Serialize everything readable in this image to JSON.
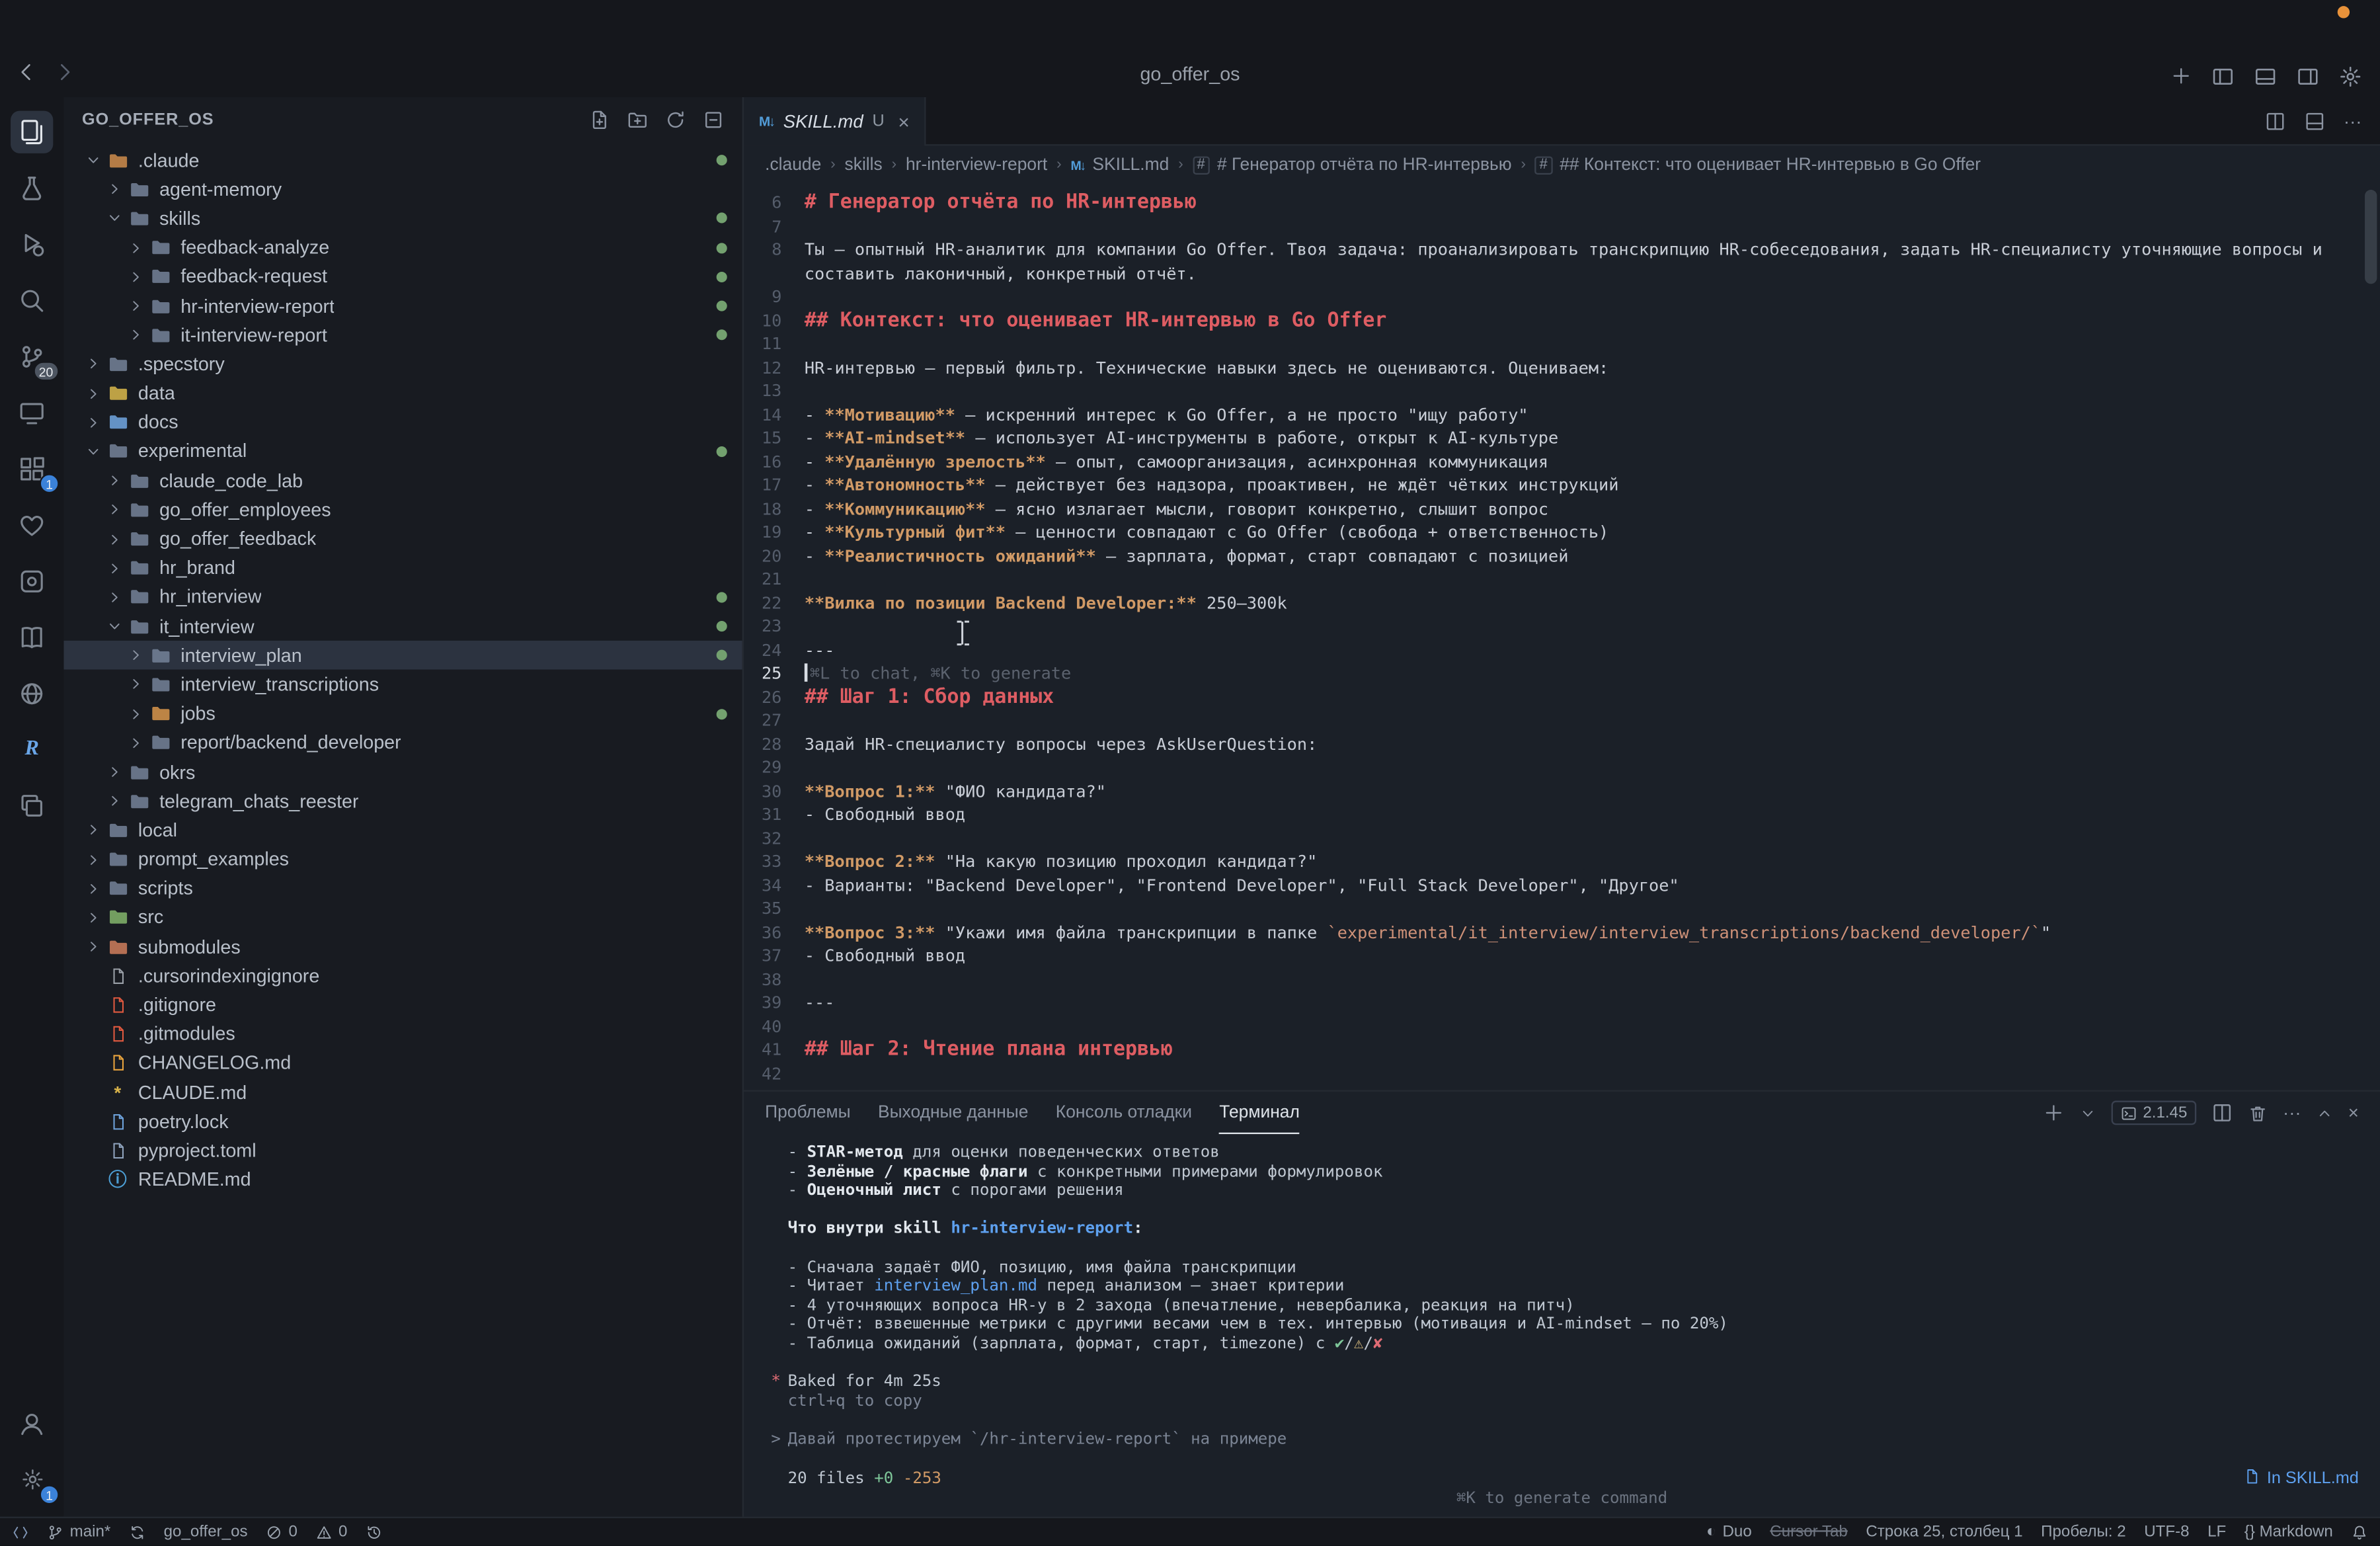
{
  "window": {
    "title": "go_offer_os"
  },
  "titlebar": {
    "nav": [
      {
        "name": "history-back-button",
        "icon": "back"
      },
      {
        "name": "history-forward-button",
        "icon": "fwd",
        "dim": true
      }
    ],
    "actions": [
      {
        "name": "new-window-button",
        "icon": "plus"
      },
      {
        "name": "toggle-primary-sidebar-button",
        "icon": "pleft"
      },
      {
        "name": "toggle-panel-button",
        "icon": "pbottom"
      },
      {
        "name": "toggle-secondary-sidebar-button",
        "icon": "pright"
      },
      {
        "name": "settings-gear-button",
        "icon": "gear"
      }
    ]
  },
  "activity_bar": {
    "top": [
      {
        "name": "explorer-view",
        "icon": "explorer",
        "active": true
      },
      {
        "name": "testing-view",
        "icon": "beaker"
      },
      {
        "name": "run-debug-view",
        "icon": "debug"
      },
      {
        "name": "search-view",
        "icon": "search"
      },
      {
        "name": "source-control-view",
        "icon": "scm",
        "badge": "20",
        "badge_style": "gray"
      },
      {
        "name": "remote-explorer-view",
        "icon": "remote"
      },
      {
        "name": "extensions-view",
        "icon": "ext",
        "badge": "1",
        "badge_style": "blue"
      },
      {
        "name": "health-view",
        "icon": "heart"
      },
      {
        "name": "tools-view",
        "icon": "tools"
      },
      {
        "name": "docs-view",
        "icon": "book"
      },
      {
        "name": "web-view",
        "icon": "globe"
      },
      {
        "name": "r-extension-view",
        "icon": "rlogo"
      },
      {
        "name": "snippets-view",
        "icon": "copy"
      }
    ],
    "bottom": [
      {
        "name": "accounts-menu",
        "icon": "account"
      },
      {
        "name": "manage-settings",
        "icon": "gear",
        "badge": "1",
        "badge_style": "blue"
      }
    ]
  },
  "sidebar": {
    "title": "GO_OFFER_OS",
    "actions": [
      {
        "name": "new-file-button",
        "icon": "newfile"
      },
      {
        "name": "new-folder-button",
        "icon": "newfolder"
      },
      {
        "name": "refresh-explorer-button",
        "icon": "refresh"
      },
      {
        "name": "collapse-folders-button",
        "icon": "collapse"
      }
    ],
    "tree": [
      {
        "label": ".claude",
        "depth": 0,
        "kind": "folder",
        "expanded": true,
        "color": "#c98a4b",
        "dot": true
      },
      {
        "label": "agent-memory",
        "depth": 1,
        "kind": "folder"
      },
      {
        "label": "skills",
        "depth": 1,
        "kind": "folder",
        "expanded": true,
        "dot": true
      },
      {
        "label": "feedback-analyze",
        "depth": 2,
        "kind": "folder",
        "dot": true
      },
      {
        "label": "feedback-request",
        "depth": 2,
        "kind": "folder",
        "dot": true
      },
      {
        "label": "hr-interview-report",
        "depth": 2,
        "kind": "folder",
        "dot": true
      },
      {
        "label": "it-interview-report",
        "depth": 2,
        "kind": "folder",
        "dot": true
      },
      {
        "label": ".specstory",
        "depth": 0,
        "kind": "folder"
      },
      {
        "label": "data",
        "depth": 0,
        "kind": "folder",
        "color": "#d4b44a"
      },
      {
        "label": "docs",
        "depth": 0,
        "kind": "folder",
        "color": "#6ea3dc"
      },
      {
        "label": "experimental",
        "depth": 0,
        "kind": "folder",
        "expanded": true,
        "dot": true
      },
      {
        "label": "claude_code_lab",
        "depth": 1,
        "kind": "folder"
      },
      {
        "label": "go_offer_employees",
        "depth": 1,
        "kind": "folder"
      },
      {
        "label": "go_offer_feedback",
        "depth": 1,
        "kind": "folder"
      },
      {
        "label": "hr_brand",
        "depth": 1,
        "kind": "folder"
      },
      {
        "label": "hr_interview",
        "depth": 1,
        "kind": "folder",
        "dot": true
      },
      {
        "label": "it_interview",
        "depth": 1,
        "kind": "folder",
        "expanded": true,
        "dot": true
      },
      {
        "label": "interview_plan",
        "depth": 2,
        "kind": "folder",
        "selected": true,
        "dot": true
      },
      {
        "label": "interview_transcriptions",
        "depth": 2,
        "kind": "folder"
      },
      {
        "label": "jobs",
        "depth": 2,
        "kind": "folder",
        "color": "#d4934a",
        "dot": true
      },
      {
        "label": "report/backend_developer",
        "depth": 2,
        "kind": "folder"
      },
      {
        "label": "okrs",
        "depth": 1,
        "kind": "folder"
      },
      {
        "label": "telegram_chats_reester",
        "depth": 1,
        "kind": "folder"
      },
      {
        "label": "local",
        "depth": 0,
        "kind": "folder"
      },
      {
        "label": "prompt_examples",
        "depth": 0,
        "kind": "folder"
      },
      {
        "label": "scripts",
        "depth": 0,
        "kind": "folder"
      },
      {
        "label": "src",
        "depth": 0,
        "kind": "folder",
        "color": "#7fb069"
      },
      {
        "label": "submodules",
        "depth": 0,
        "kind": "folder",
        "color": "#c97b5a"
      },
      {
        "label": ".cursorindexingignore",
        "depth": 0,
        "kind": "file",
        "color": "#9aa0a8"
      },
      {
        "label": ".gitignore",
        "depth": 0,
        "kind": "file",
        "color": "#e0593f"
      },
      {
        "label": ".gitmodules",
        "depth": 0,
        "kind": "file",
        "color": "#e0593f"
      },
      {
        "label": "CHANGELOG.md",
        "depth": 0,
        "kind": "file",
        "color": "#e8a33d"
      },
      {
        "label": "CLAUDE.md",
        "depth": 0,
        "kind": "file",
        "color": "#d9b44a",
        "glyph": "*"
      },
      {
        "label": "poetry.lock",
        "depth": 0,
        "kind": "file",
        "color": "#6ea3dc"
      },
      {
        "label": "pyproject.toml",
        "depth": 0,
        "kind": "file",
        "color": "#8fa3bd"
      },
      {
        "label": "README.md",
        "depth": 0,
        "kind": "file",
        "color": "#4d9fd6",
        "glyph": "ⓘ"
      }
    ]
  },
  "editor": {
    "tab": {
      "name": "SKILL.md",
      "badge": "U"
    },
    "tab_actions": [
      {
        "name": "split-editor-button",
        "icon": "split"
      },
      {
        "name": "toggle-editor-layout-button",
        "icon": "layout"
      },
      {
        "name": "more-editor-actions-button",
        "icon": "more"
      }
    ],
    "breadcrumbs": [
      {
        "label": ".claude"
      },
      {
        "label": "skills"
      },
      {
        "label": "hr-interview-report"
      },
      {
        "label": "SKILL.md",
        "icon": "md"
      },
      {
        "label": "# Генератор отчёта по HR-интервью",
        "icon": "sym"
      },
      {
        "label": "## Контекст: что оценивает HR-интервью в Go Offer",
        "icon": "sym"
      }
    ],
    "ghost_text": "⌘L to chat, ⌘K to generate",
    "lines": [
      {
        "n": 6,
        "s": [
          [
            "h",
            "# Генератор отчёта по HR-интервью"
          ]
        ]
      },
      {
        "n": 7,
        "s": []
      },
      {
        "n": 8,
        "s": [
          [
            "d",
            "Ты — опытный HR-аналитик для компании Go Offer. Твоя задача: проанализировать транскрипцию HR-собеседования, задать HR-специалисту уточняющие вопросы и"
          ]
        ]
      },
      {
        "s": [
          [
            "d",
            "составить лаконичный, конкретный отчёт."
          ]
        ]
      },
      {
        "n": 9,
        "s": []
      },
      {
        "n": 10,
        "s": [
          [
            "h",
            "## Контекст: что оценивает HR-интервью в Go Offer"
          ]
        ]
      },
      {
        "n": 11,
        "s": []
      },
      {
        "n": 12,
        "s": [
          [
            "d",
            "HR-интервью — первый фильтр. Технические навыки здесь не оцениваются. Оцениваем:"
          ]
        ]
      },
      {
        "n": 13,
        "s": []
      },
      {
        "n": 14,
        "s": [
          [
            "d",
            "- "
          ],
          [
            "b",
            "**Мотивацию**"
          ],
          [
            "d",
            " — искренний интерес к Go Offer, а не просто \"ищу работу\""
          ]
        ]
      },
      {
        "n": 15,
        "s": [
          [
            "d",
            "- "
          ],
          [
            "b",
            "**AI-mindset**"
          ],
          [
            "d",
            " — использует AI-инструменты в работе, открыт к AI-культуре"
          ]
        ]
      },
      {
        "n": 16,
        "s": [
          [
            "d",
            "- "
          ],
          [
            "b",
            "**Удалённую зрелость**"
          ],
          [
            "d",
            " — опыт, самоорганизация, асинхронная коммуникация"
          ]
        ]
      },
      {
        "n": 17,
        "s": [
          [
            "d",
            "- "
          ],
          [
            "b",
            "**Автономность**"
          ],
          [
            "d",
            " — действует без надзора, проактивен, не ждёт чётких инструкций"
          ]
        ]
      },
      {
        "n": 18,
        "s": [
          [
            "d",
            "- "
          ],
          [
            "b",
            "**Коммуникацию**"
          ],
          [
            "d",
            " — ясно излагает мысли, говорит конкретно, слышит вопрос"
          ]
        ]
      },
      {
        "n": 19,
        "s": [
          [
            "d",
            "- "
          ],
          [
            "b",
            "**Культурный фит**"
          ],
          [
            "d",
            " — ценности совпадают с Go Offer (свобода + ответственность)"
          ]
        ]
      },
      {
        "n": 20,
        "s": [
          [
            "d",
            "- "
          ],
          [
            "b",
            "**Реалистичность ожиданий**"
          ],
          [
            "d",
            " — зарплата, формат, старт совпадают с позицией"
          ]
        ]
      },
      {
        "n": 21,
        "s": []
      },
      {
        "n": 22,
        "s": [
          [
            "b",
            "**Вилка по позиции Backend Developer:**"
          ],
          [
            "d",
            " 250–300k"
          ]
        ]
      },
      {
        "n": 23,
        "s": []
      },
      {
        "n": 24,
        "s": [
          [
            "d",
            "---"
          ]
        ]
      },
      {
        "n": 25,
        "active": true,
        "caret": true,
        "s": [
          [
            "g",
            "⌘L to chat, ⌘K to generate"
          ]
        ]
      },
      {
        "n": 26,
        "s": [
          [
            "h",
            "## Шаг 1: Сбор данных"
          ]
        ]
      },
      {
        "n": 27,
        "s": []
      },
      {
        "n": 28,
        "s": [
          [
            "d",
            "Задай HR-специалисту вопросы через AskUserQuestion:"
          ]
        ]
      },
      {
        "n": 29,
        "s": []
      },
      {
        "n": 30,
        "s": [
          [
            "b",
            "**Вопрос 1:**"
          ],
          [
            "d",
            " \"ФИО кандидата?\""
          ]
        ]
      },
      {
        "n": 31,
        "s": [
          [
            "d",
            "- Свободный ввод"
          ]
        ]
      },
      {
        "n": 32,
        "s": []
      },
      {
        "n": 33,
        "s": [
          [
            "b",
            "**Вопрос 2:**"
          ],
          [
            "d",
            " \"На какую позицию проходил кандидат?\""
          ]
        ]
      },
      {
        "n": 34,
        "s": [
          [
            "d",
            "- Варианты: \"Backend Developer\", \"Frontend Developer\", \"Full Stack Developer\", \"Другое\""
          ]
        ]
      },
      {
        "n": 35,
        "s": []
      },
      {
        "n": 36,
        "s": [
          [
            "b",
            "**Вопрос 3:**"
          ],
          [
            "d",
            " \"Укажи имя файла транскрипции в папке "
          ],
          [
            "c",
            "`experimental/it_interview/interview_transcriptions/backend_developer/`"
          ],
          [
            "d",
            "\""
          ]
        ]
      },
      {
        "n": 37,
        "s": [
          [
            "d",
            "- Свободный ввод"
          ]
        ]
      },
      {
        "n": 38,
        "s": []
      },
      {
        "n": 39,
        "s": [
          [
            "d",
            "---"
          ]
        ]
      },
      {
        "n": 40,
        "s": []
      },
      {
        "n": 41,
        "s": [
          [
            "h",
            "## Шаг 2: Чтение плана интервью"
          ]
        ]
      },
      {
        "n": 42,
        "s": []
      }
    ]
  },
  "panel": {
    "tabs": [
      "Проблемы",
      "Выходные данные",
      "Консоль отладки",
      "Терминал"
    ],
    "active_tab": "Терминал",
    "version": "2.1.45",
    "actions": [
      {
        "name": "new-terminal-button",
        "icon": "plus"
      },
      {
        "name": "terminal-picker-button",
        "icon": "chevdown"
      },
      {
        "name": "terminal-version-pill",
        "pill": true
      },
      {
        "name": "split-terminal-button",
        "icon": "split"
      },
      {
        "name": "kill-terminal-button",
        "icon": "trash"
      },
      {
        "name": "more-terminal-actions-button",
        "icon": "more"
      },
      {
        "name": "maximize-panel-button",
        "icon": "chevup"
      },
      {
        "name": "close-panel-button",
        "icon": "close"
      }
    ],
    "terminal_lines": [
      {
        "s": [
          [
            "t",
            "- "
          ],
          [
            "w",
            "STAR-метод"
          ],
          [
            "t",
            " для оценки поведенческих ответов"
          ]
        ]
      },
      {
        "s": [
          [
            "t",
            "- "
          ],
          [
            "w",
            "Зелёные / красные флаги"
          ],
          [
            "t",
            " с конкретными примерами формулировок"
          ]
        ]
      },
      {
        "s": [
          [
            "t",
            "- "
          ],
          [
            "w",
            "Оценочный лист"
          ],
          [
            "t",
            " с порогами решения"
          ]
        ]
      },
      {
        "s": []
      },
      {
        "s": [
          [
            "w",
            "Что внутри skill "
          ],
          [
            "lb",
            "hr-interview-report"
          ],
          [
            "w",
            ":"
          ]
        ]
      },
      {
        "s": []
      },
      {
        "s": [
          [
            "t",
            "- Сначала задаёт ФИО, позицию, имя файла транскрипции"
          ]
        ]
      },
      {
        "s": [
          [
            "t",
            "- Читает "
          ],
          [
            "l",
            "interview_plan.md"
          ],
          [
            "t",
            " перед анализом — знает критерии"
          ]
        ]
      },
      {
        "s": [
          [
            "t",
            "- 4 уточняющих вопроса HR-у в 2 захода (впечатление, невербалика, реакция на питч)"
          ]
        ]
      },
      {
        "s": [
          [
            "t",
            "- Отчёт: взвешенные метрики с другими весами чем в тех. интервью (мотивация и AI-mindset — по 20%)"
          ]
        ]
      },
      {
        "s": [
          [
            "t",
            "- Таблица ожиданий (зарплата, формат, старт, timezone) с "
          ],
          [
            "g",
            "✔"
          ],
          [
            "t",
            "/"
          ],
          [
            "y",
            "⚠"
          ],
          [
            "t",
            "/"
          ],
          [
            "r",
            "✘"
          ]
        ]
      },
      {
        "s": []
      },
      {
        "m": [
          "*",
          "r"
        ],
        "s": [
          [
            "t",
            "Baked for 4m 25s"
          ]
        ]
      },
      {
        "s": [
          [
            "dim",
            "ctrl+q to copy"
          ]
        ]
      },
      {
        "s": []
      },
      {
        "m": [
          ">",
          "dim"
        ],
        "s": [
          [
            "dim",
            "Давай протестируем `/hr-interview-report` на примере"
          ]
        ]
      },
      {
        "s": []
      }
    ],
    "files": {
      "label": "20 files",
      "added": "+0",
      "removed": "-253"
    },
    "context_badge": "In SKILL.md",
    "hint": "⌘K to generate command"
  },
  "status_bar": {
    "left": [
      {
        "name": "remote-indicator",
        "icon": "remote-sm"
      },
      {
        "name": "git-branch",
        "icon": "branch",
        "label": "main*"
      },
      {
        "name": "git-sync-button",
        "icon": "sync"
      },
      {
        "name": "project-name",
        "label": "go_offer_os"
      },
      {
        "name": "errors-count",
        "icon": "error",
        "label": "0"
      },
      {
        "name": "warnings-count",
        "icon": "warn",
        "label": "0"
      },
      {
        "name": "timeline-history",
        "icon": "history"
      }
    ],
    "right": [
      {
        "name": "duo-toggle",
        "icon": "duo",
        "label": "Duo"
      },
      {
        "name": "cursor-tab-toggle",
        "label": "Cursor Tab",
        "style": "strike"
      },
      {
        "name": "cursor-position",
        "label": "Строка 25, столбец 1"
      },
      {
        "name": "indentation-setting",
        "label": "Пробелы: 2"
      },
      {
        "name": "encoding-setting",
        "label": "UTF-8"
      },
      {
        "name": "eol-setting",
        "label": "LF"
      },
      {
        "name": "language-mode",
        "label": "{} Markdown"
      },
      {
        "name": "notifications-bell",
        "icon": "bell"
      }
    ]
  }
}
